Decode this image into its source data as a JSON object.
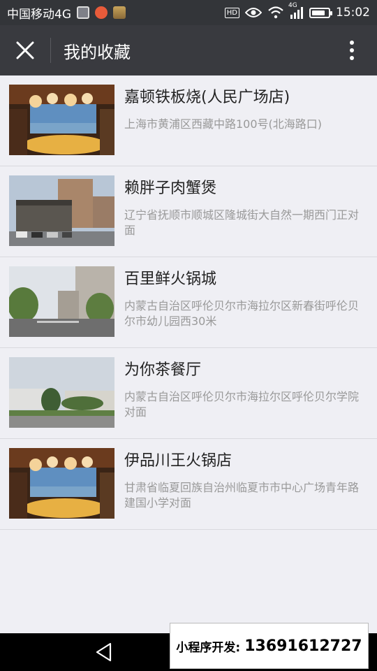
{
  "status_bar": {
    "carrier": "中国移动4G",
    "time": "15:02",
    "hd_badge": "HD",
    "network_badge": "4G",
    "battery_level": 0.8,
    "notification_icons": [
      "gallery-icon",
      "app-icon",
      "photo-icon"
    ]
  },
  "nav": {
    "title": "我的收藏"
  },
  "favorites": [
    {
      "name": "嘉顿铁板烧(人民广场店)",
      "address": "上海市黄浦区西藏中路100号(北海路口)",
      "thumb": "restaurant-interior"
    },
    {
      "name": "赖胖子肉蟹煲",
      "address": "辽宁省抚顺市顺城区隆城街大自然一期西门正对面",
      "thumb": "street-building"
    },
    {
      "name": "百里鲜火锅城",
      "address": "内蒙古自治区呼伦贝尔市海拉尔区新春街呼伦贝尔市幼儿园西30米",
      "thumb": "street-trees"
    },
    {
      "name": "为你茶餐厅",
      "address": "内蒙古自治区呼伦贝尔市海拉尔区呼伦贝尔学院对面",
      "thumb": "campus"
    },
    {
      "name": "伊品川王火锅店",
      "address": "甘肃省临夏回族自治州临夏市市中心广场青年路建国小学对面",
      "thumb": "restaurant-interior"
    }
  ],
  "watermark": {
    "label": "小程序开发:",
    "phone": "13691612727"
  },
  "colors": {
    "status_bar": "#333539",
    "nav_bar": "#393a3f",
    "background": "#efeff4"
  }
}
